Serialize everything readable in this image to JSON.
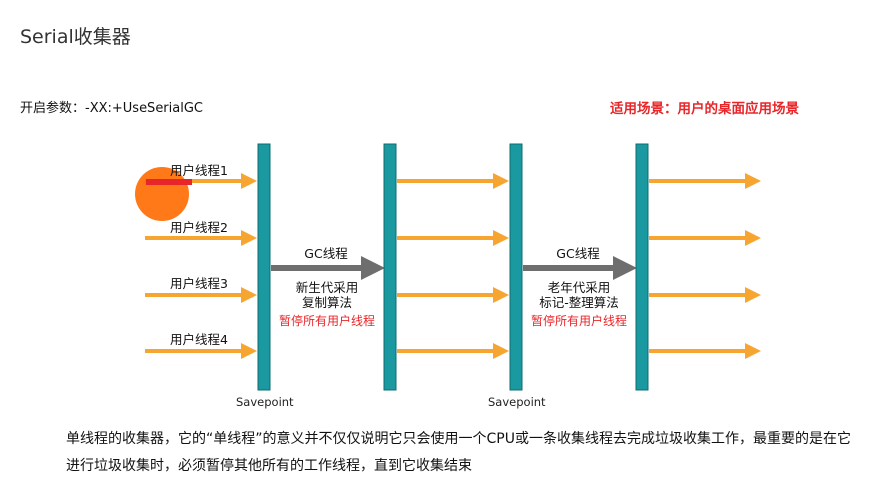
{
  "title": "Serial收集器",
  "param_text": "开启参数：-XX:+UseSerialGC",
  "scene_text": "适用场景：用户的桌面应用场景",
  "threads": [
    {
      "label": "用户线程1"
    },
    {
      "label": "用户线程2"
    },
    {
      "label": "用户线程3"
    },
    {
      "label": "用户线程4"
    }
  ],
  "gc_phases": [
    {
      "label": "GC线程",
      "desc_line1": "新生代采用",
      "desc_line2": "复制算法",
      "stop_text": "暂停所有用户线程"
    },
    {
      "label": "GC线程",
      "desc_line1": "老年代采用",
      "desc_line2": "标记-整理算法",
      "stop_text": "暂停所有用户线程"
    }
  ],
  "savepoints": [
    "Savepoint",
    "Savepoint"
  ],
  "summary_text": "单线程的收集器，它的“单线程”的意义并不仅仅说明它只会使用一个CPU或一条收集线程去完成垃圾收集工作，最重要的是在它进行垃圾收集时，必须暂停其他所有的工作线程，直到它收集结束",
  "colors": {
    "arrow": "#f7a531",
    "bar": "#1a9aa0",
    "gc_arrow": "#6e6e6e",
    "highlight": "#e8262a",
    "cursor": "#ff6a00"
  }
}
